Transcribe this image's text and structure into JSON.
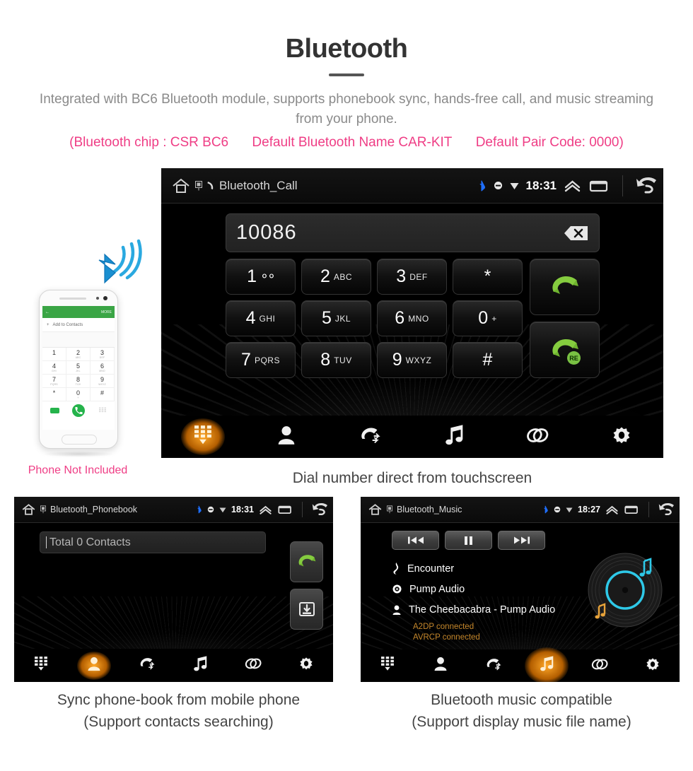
{
  "header": {
    "title": "Bluetooth",
    "description": "Integrated with BC6 Bluetooth module, supports phonebook sync, hands-free call, and music streaming from your phone.",
    "spec_chip": "(Bluetooth chip : CSR BC6",
    "spec_name": "Default Bluetooth Name CAR-KIT",
    "spec_pair": "Default Pair Code: 0000)",
    "accent_pink": "#ef3d85",
    "text_grey": "#8a8a8a"
  },
  "phone_mock": {
    "not_included_label": "Phone Not Included",
    "appbar_more": "MORE",
    "add_to_contacts": "Add to Contacts",
    "keys": [
      {
        "digit": "1",
        "letters": ""
      },
      {
        "digit": "2",
        "letters": "ABC"
      },
      {
        "digit": "3",
        "letters": "DEF"
      },
      {
        "digit": "4",
        "letters": "GHI"
      },
      {
        "digit": "5",
        "letters": "JKL"
      },
      {
        "digit": "6",
        "letters": "MNO"
      },
      {
        "digit": "7",
        "letters": "PQRS"
      },
      {
        "digit": "8",
        "letters": "TUV"
      },
      {
        "digit": "9",
        "letters": "WXYZ"
      },
      {
        "digit": "*",
        "letters": ""
      },
      {
        "digit": "0",
        "letters": "+"
      },
      {
        "digit": "#",
        "letters": ""
      }
    ]
  },
  "dialer": {
    "statusbar": {
      "title": "Bluetooth_Call",
      "clock": "18:31"
    },
    "number_value": "10086",
    "keypad": [
      [
        {
          "digit": "1",
          "letters": "",
          "voicemail": true
        },
        {
          "digit": "2",
          "letters": "ABC"
        },
        {
          "digit": "3",
          "letters": "DEF"
        },
        {
          "digit": "*",
          "letters": ""
        }
      ],
      [
        {
          "digit": "4",
          "letters": "GHI"
        },
        {
          "digit": "5",
          "letters": "JKL"
        },
        {
          "digit": "6",
          "letters": "MNO"
        },
        {
          "digit": "0",
          "letters": "+"
        }
      ],
      [
        {
          "digit": "7",
          "letters": "PQRS"
        },
        {
          "digit": "8",
          "letters": "TUV"
        },
        {
          "digit": "9",
          "letters": "WXYZ"
        },
        {
          "digit": "#",
          "letters": ""
        }
      ]
    ],
    "redial_badge": "RE",
    "nav": [
      {
        "name": "keypad",
        "icon": "keypad-icon",
        "active": true
      },
      {
        "name": "contacts",
        "icon": "contact-icon",
        "active": false
      },
      {
        "name": "call-history",
        "icon": "call-history-icon",
        "active": false
      },
      {
        "name": "music",
        "icon": "music-note-icon",
        "active": false
      },
      {
        "name": "link",
        "icon": "link-icon",
        "active": false
      },
      {
        "name": "settings",
        "icon": "gear-icon",
        "active": false
      }
    ],
    "caption": "Dial number direct from touchscreen"
  },
  "phonebook": {
    "statusbar": {
      "title": "Bluetooth_Phonebook",
      "clock": "18:31"
    },
    "search_text": "Total 0 Contacts",
    "nav": [
      {
        "name": "keypad",
        "icon": "keypad-icon",
        "active": false
      },
      {
        "name": "contacts",
        "icon": "contact-icon",
        "active": true
      },
      {
        "name": "call-history",
        "icon": "call-history-icon",
        "active": false
      },
      {
        "name": "music",
        "icon": "music-note-icon",
        "active": false
      },
      {
        "name": "link",
        "icon": "link-icon",
        "active": false
      },
      {
        "name": "settings",
        "icon": "gear-icon",
        "active": false
      }
    ],
    "caption_line1": "Sync phone-book from mobile phone",
    "caption_line2": "(Support contacts searching)"
  },
  "music": {
    "statusbar": {
      "title": "Bluetooth_Music",
      "clock": "18:27"
    },
    "controls": [
      {
        "name": "previous-track",
        "icon": "prev-icon"
      },
      {
        "name": "pause",
        "icon": "pause-icon"
      },
      {
        "name": "next-track",
        "icon": "next-icon"
      }
    ],
    "track_title": "Encounter",
    "album": "Pump Audio",
    "artist": "The Cheebacabra - Pump Audio",
    "status_a2dp": "A2DP connected",
    "status_avrcp": "AVRCP connected",
    "nav": [
      {
        "name": "keypad",
        "icon": "keypad-icon",
        "active": false
      },
      {
        "name": "contacts",
        "icon": "contact-icon",
        "active": false
      },
      {
        "name": "call-history",
        "icon": "call-history-icon",
        "active": false
      },
      {
        "name": "music",
        "icon": "music-note-icon",
        "active": true
      },
      {
        "name": "link",
        "icon": "link-icon",
        "active": false
      },
      {
        "name": "settings",
        "icon": "gear-icon",
        "active": false
      }
    ],
    "caption_line1": "Bluetooth music compatible",
    "caption_line2": "(Support display music file name)"
  }
}
